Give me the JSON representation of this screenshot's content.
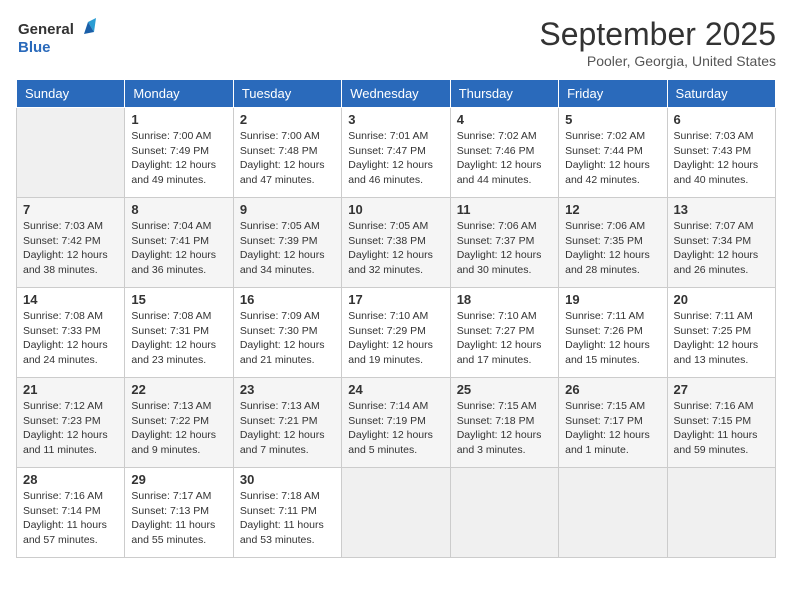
{
  "header": {
    "logo_line1": "General",
    "logo_line2": "Blue",
    "title": "September 2025",
    "subtitle": "Pooler, Georgia, United States"
  },
  "days_of_week": [
    "Sunday",
    "Monday",
    "Tuesday",
    "Wednesday",
    "Thursday",
    "Friday",
    "Saturday"
  ],
  "weeks": [
    [
      null,
      {
        "day": "1",
        "sunrise": "7:00 AM",
        "sunset": "7:49 PM",
        "daylight": "12 hours and 49 minutes."
      },
      {
        "day": "2",
        "sunrise": "7:00 AM",
        "sunset": "7:48 PM",
        "daylight": "12 hours and 47 minutes."
      },
      {
        "day": "3",
        "sunrise": "7:01 AM",
        "sunset": "7:47 PM",
        "daylight": "12 hours and 46 minutes."
      },
      {
        "day": "4",
        "sunrise": "7:02 AM",
        "sunset": "7:46 PM",
        "daylight": "12 hours and 44 minutes."
      },
      {
        "day": "5",
        "sunrise": "7:02 AM",
        "sunset": "7:44 PM",
        "daylight": "12 hours and 42 minutes."
      },
      {
        "day": "6",
        "sunrise": "7:03 AM",
        "sunset": "7:43 PM",
        "daylight": "12 hours and 40 minutes."
      }
    ],
    [
      {
        "day": "7",
        "sunrise": "7:03 AM",
        "sunset": "7:42 PM",
        "daylight": "12 hours and 38 minutes."
      },
      {
        "day": "8",
        "sunrise": "7:04 AM",
        "sunset": "7:41 PM",
        "daylight": "12 hours and 36 minutes."
      },
      {
        "day": "9",
        "sunrise": "7:05 AM",
        "sunset": "7:39 PM",
        "daylight": "12 hours and 34 minutes."
      },
      {
        "day": "10",
        "sunrise": "7:05 AM",
        "sunset": "7:38 PM",
        "daylight": "12 hours and 32 minutes."
      },
      {
        "day": "11",
        "sunrise": "7:06 AM",
        "sunset": "7:37 PM",
        "daylight": "12 hours and 30 minutes."
      },
      {
        "day": "12",
        "sunrise": "7:06 AM",
        "sunset": "7:35 PM",
        "daylight": "12 hours and 28 minutes."
      },
      {
        "day": "13",
        "sunrise": "7:07 AM",
        "sunset": "7:34 PM",
        "daylight": "12 hours and 26 minutes."
      }
    ],
    [
      {
        "day": "14",
        "sunrise": "7:08 AM",
        "sunset": "7:33 PM",
        "daylight": "12 hours and 24 minutes."
      },
      {
        "day": "15",
        "sunrise": "7:08 AM",
        "sunset": "7:31 PM",
        "daylight": "12 hours and 23 minutes."
      },
      {
        "day": "16",
        "sunrise": "7:09 AM",
        "sunset": "7:30 PM",
        "daylight": "12 hours and 21 minutes."
      },
      {
        "day": "17",
        "sunrise": "7:10 AM",
        "sunset": "7:29 PM",
        "daylight": "12 hours and 19 minutes."
      },
      {
        "day": "18",
        "sunrise": "7:10 AM",
        "sunset": "7:27 PM",
        "daylight": "12 hours and 17 minutes."
      },
      {
        "day": "19",
        "sunrise": "7:11 AM",
        "sunset": "7:26 PM",
        "daylight": "12 hours and 15 minutes."
      },
      {
        "day": "20",
        "sunrise": "7:11 AM",
        "sunset": "7:25 PM",
        "daylight": "12 hours and 13 minutes."
      }
    ],
    [
      {
        "day": "21",
        "sunrise": "7:12 AM",
        "sunset": "7:23 PM",
        "daylight": "12 hours and 11 minutes."
      },
      {
        "day": "22",
        "sunrise": "7:13 AM",
        "sunset": "7:22 PM",
        "daylight": "12 hours and 9 minutes."
      },
      {
        "day": "23",
        "sunrise": "7:13 AM",
        "sunset": "7:21 PM",
        "daylight": "12 hours and 7 minutes."
      },
      {
        "day": "24",
        "sunrise": "7:14 AM",
        "sunset": "7:19 PM",
        "daylight": "12 hours and 5 minutes."
      },
      {
        "day": "25",
        "sunrise": "7:15 AM",
        "sunset": "7:18 PM",
        "daylight": "12 hours and 3 minutes."
      },
      {
        "day": "26",
        "sunrise": "7:15 AM",
        "sunset": "7:17 PM",
        "daylight": "12 hours and 1 minute."
      },
      {
        "day": "27",
        "sunrise": "7:16 AM",
        "sunset": "7:15 PM",
        "daylight": "11 hours and 59 minutes."
      }
    ],
    [
      {
        "day": "28",
        "sunrise": "7:16 AM",
        "sunset": "7:14 PM",
        "daylight": "11 hours and 57 minutes."
      },
      {
        "day": "29",
        "sunrise": "7:17 AM",
        "sunset": "7:13 PM",
        "daylight": "11 hours and 55 minutes."
      },
      {
        "day": "30",
        "sunrise": "7:18 AM",
        "sunset": "7:11 PM",
        "daylight": "11 hours and 53 minutes."
      },
      null,
      null,
      null,
      null
    ]
  ]
}
